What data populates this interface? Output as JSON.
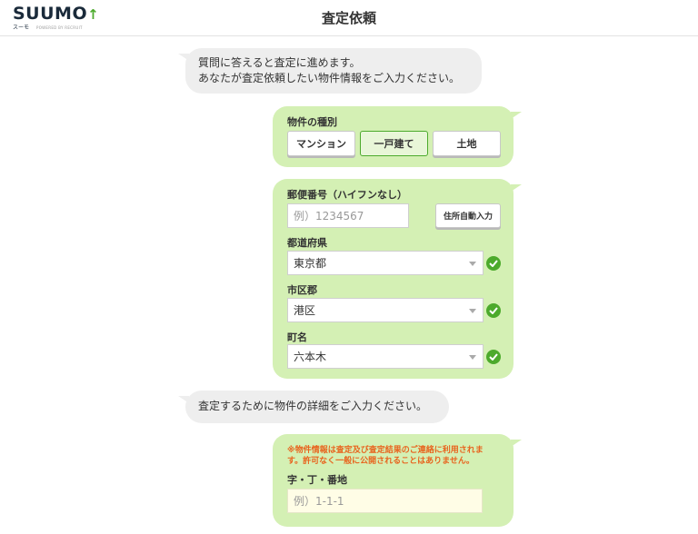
{
  "header": {
    "logo_text": "SUUMO",
    "logo_sub": "スーモ",
    "logo_powered": "POWERED BY RECRUIT",
    "title": "査定依頼"
  },
  "bot_message_1": {
    "line1": "質問に答えると査定に進めます。",
    "line2": "あなたが査定依頼したい物件情報をご入力ください。"
  },
  "property_type": {
    "label": "物件の種別",
    "options": [
      "マンション",
      "一戸建て",
      "土地"
    ],
    "selected": "一戸建て"
  },
  "address": {
    "postal_label": "郵便番号（ハイフンなし）",
    "postal_placeholder": "例）1234567",
    "auto_fill_button": "住所自動入力",
    "prefecture_label": "都道府県",
    "prefecture_value": "東京都",
    "city_label": "市区郡",
    "city_value": "港区",
    "town_label": "町名",
    "town_value": "六本木"
  },
  "bot_message_2": {
    "text": "査定するために物件の詳細をご入力ください。"
  },
  "details": {
    "notice": "※物件情報は査定及び査定結果のご連絡に利用されます。許可なく一般に公開されることはありません。",
    "block_label": "字・丁・番地",
    "block_placeholder": "例）1-1-1"
  },
  "colors": {
    "accent_green": "#4caa2c",
    "bubble_green": "#d4f0b4",
    "bubble_gray": "#eeeeee",
    "notice_orange": "#e8641e"
  }
}
